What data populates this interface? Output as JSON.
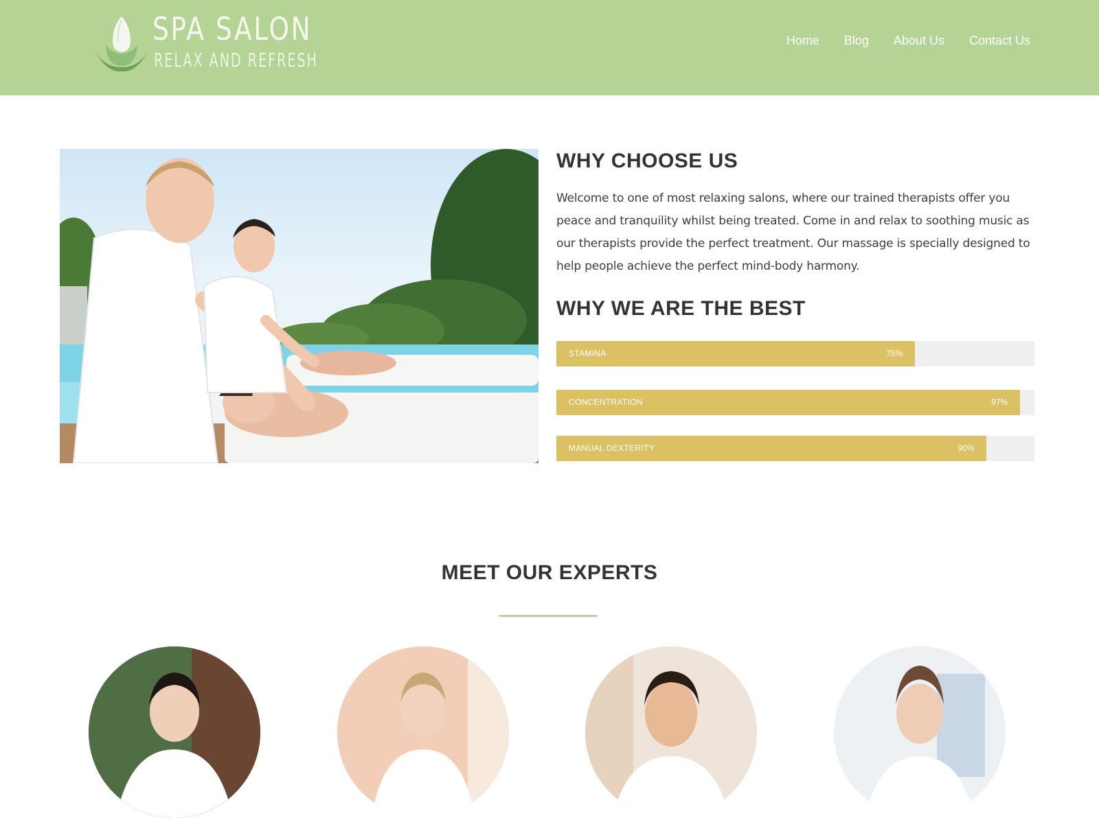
{
  "brand": {
    "title": "SPA SALON",
    "tagline": "RELAX AND REFRESH"
  },
  "nav": {
    "items": [
      "Home",
      "Blog",
      "About Us",
      "Contact Us"
    ]
  },
  "about": {
    "heading": "WHY CHOOSE US",
    "body": "Welcome to one of most relaxing salons, where our trained therapists offer you peace and tranquility whilst being treated. Come in and relax to soothing music as our therapists provide the perfect treatment. Our massage is specially designed to help people achieve the perfect mind-body harmony."
  },
  "skills": {
    "heading": "WHY WE ARE THE BEST",
    "items": [
      {
        "label": "STAMINA",
        "percent_text": "75%",
        "percent": 75
      },
      {
        "label": "CONCENTRATION",
        "percent_text": "97%",
        "percent": 97
      },
      {
        "label": "MANUAL DEXTERITY",
        "percent_text": "90%",
        "percent": 90
      }
    ]
  },
  "experts": {
    "heading": "MEET OUR EXPERTS"
  },
  "colors": {
    "header_bg": "#b6d396",
    "bar_fill": "#dbc064",
    "bar_track": "#efefef",
    "divider": "#b6d396"
  }
}
